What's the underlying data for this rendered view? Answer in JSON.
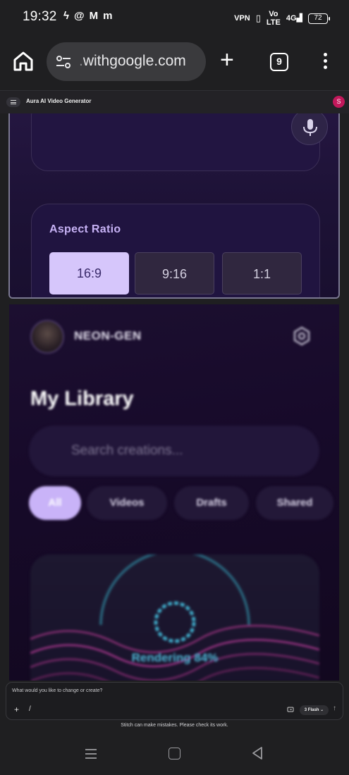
{
  "status_bar": {
    "time": "19:32",
    "left_icons": [
      "flash-icon",
      "threads-icon",
      "gmail-icon",
      "m-app-icon"
    ],
    "vpn": "VPN",
    "volte_top": "Vo",
    "volte_bottom": "LTE",
    "network": "4G",
    "battery": "72"
  },
  "browser": {
    "url_faded": ".",
    "url_text": "withgoogle.com",
    "tab_count": "9"
  },
  "app_header": {
    "title": "Aura AI Video Generator",
    "avatar_initial": "S"
  },
  "generator": {
    "aspect_ratio_title": "Aspect Ratio",
    "aspect_options": [
      "16:9",
      "9:16",
      "1:1"
    ],
    "selected_aspect": "16:9"
  },
  "library": {
    "username": "NEON-GEN",
    "title": "My Library",
    "search_placeholder": "Search creations...",
    "filters": [
      "All",
      "Videos",
      "Drafts",
      "Shared"
    ],
    "selected_filter": "All",
    "render_status": "Rendering 84%"
  },
  "chat": {
    "placeholder": "What would you like to change or create?",
    "model_label": "3 Flash",
    "disclaimer": "Stitch can make mistakes. Please check its work."
  },
  "colors": {
    "accent_lavender": "#d6c6fb",
    "bg_purple": "#1c1133",
    "render_cyan": "#4fb7d6",
    "avatar_pink": "#c2185b"
  }
}
